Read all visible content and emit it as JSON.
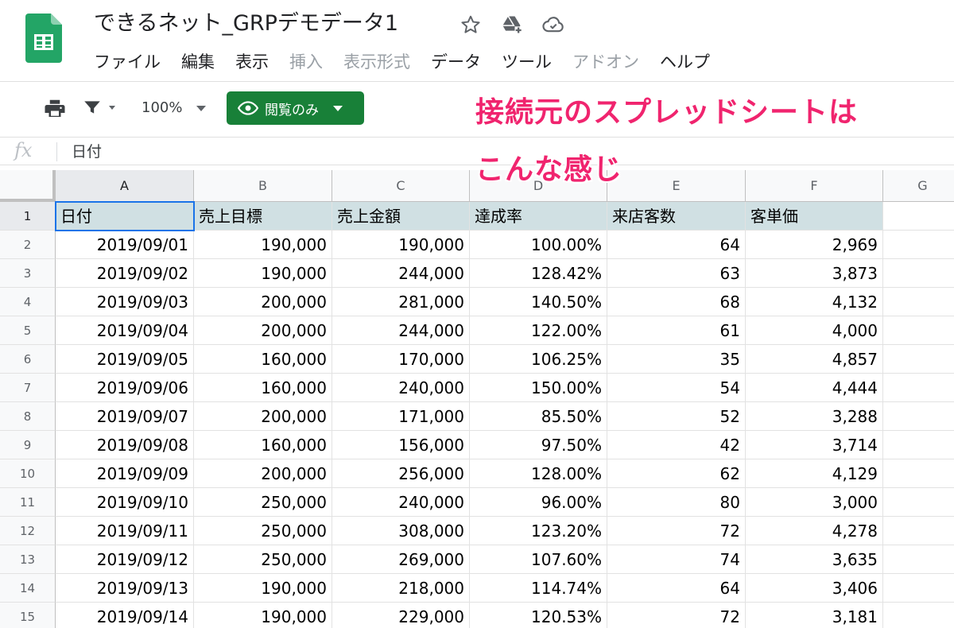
{
  "app": {
    "title": "できるネット_GRPデモデータ1",
    "icons": [
      "star-icon",
      "drive-add-icon",
      "cloud-status-icon"
    ]
  },
  "menu": {
    "items": [
      {
        "label": "ファイル",
        "enabled": true
      },
      {
        "label": "編集",
        "enabled": true
      },
      {
        "label": "表示",
        "enabled": true
      },
      {
        "label": "挿入",
        "enabled": false
      },
      {
        "label": "表示形式",
        "enabled": false
      },
      {
        "label": "データ",
        "enabled": true
      },
      {
        "label": "ツール",
        "enabled": true
      },
      {
        "label": "アドオン",
        "enabled": false
      },
      {
        "label": "ヘルプ",
        "enabled": true
      }
    ]
  },
  "toolbar": {
    "zoom": "100%",
    "view_only_label": "閲覧のみ"
  },
  "annotation": {
    "line1": "接続元のスプレッドシートは",
    "line2": "こんな感じ"
  },
  "formula_bar": {
    "fx": "fx",
    "value": "日付"
  },
  "colors": {
    "accent_green": "#188038",
    "header_fill": "#d0e0e3",
    "annotation": "#f0246e",
    "selection": "#1a73e8"
  },
  "sheet": {
    "column_letters": [
      "A",
      "B",
      "C",
      "D",
      "E",
      "F",
      "G"
    ],
    "selected_cell": "A1",
    "header_row": [
      "日付",
      "売上目標",
      "売上金額",
      "達成率",
      "来店客数",
      "客単価"
    ],
    "rows": [
      [
        "2019/09/01",
        "190,000",
        "190,000",
        "100.00%",
        "64",
        "2,969"
      ],
      [
        "2019/09/02",
        "190,000",
        "244,000",
        "128.42%",
        "63",
        "3,873"
      ],
      [
        "2019/09/03",
        "200,000",
        "281,000",
        "140.50%",
        "68",
        "4,132"
      ],
      [
        "2019/09/04",
        "200,000",
        "244,000",
        "122.00%",
        "61",
        "4,000"
      ],
      [
        "2019/09/05",
        "160,000",
        "170,000",
        "106.25%",
        "35",
        "4,857"
      ],
      [
        "2019/09/06",
        "160,000",
        "240,000",
        "150.00%",
        "54",
        "4,444"
      ],
      [
        "2019/09/07",
        "200,000",
        "171,000",
        "85.50%",
        "52",
        "3,288"
      ],
      [
        "2019/09/08",
        "160,000",
        "156,000",
        "97.50%",
        "42",
        "3,714"
      ],
      [
        "2019/09/09",
        "200,000",
        "256,000",
        "128.00%",
        "62",
        "4,129"
      ],
      [
        "2019/09/10",
        "250,000",
        "240,000",
        "96.00%",
        "80",
        "3,000"
      ],
      [
        "2019/09/11",
        "250,000",
        "308,000",
        "123.20%",
        "72",
        "4,278"
      ],
      [
        "2019/09/12",
        "250,000",
        "269,000",
        "107.60%",
        "74",
        "3,635"
      ],
      [
        "2019/09/13",
        "190,000",
        "218,000",
        "114.74%",
        "64",
        "3,406"
      ],
      [
        "2019/09/14",
        "190,000",
        "229,000",
        "120.53%",
        "72",
        "3,181"
      ]
    ]
  }
}
